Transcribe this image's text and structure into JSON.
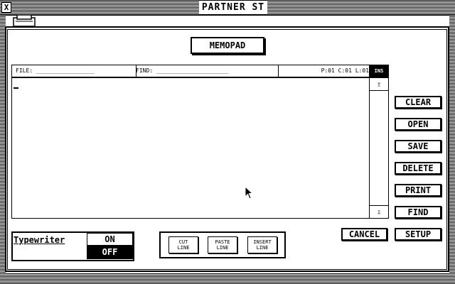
{
  "window": {
    "title": "PARTNER ST",
    "close_glyph": "X"
  },
  "dialog": {
    "heading": "MEMOPAD"
  },
  "infobar": {
    "file": "FILE: _________________",
    "find": "FIND: _____________________",
    "position": "P:01 C:01 L:01",
    "mode": "INS"
  },
  "editor": {
    "content": ""
  },
  "scrollbar": {
    "up_glyph": "⇧",
    "down_glyph": "⇩"
  },
  "side_buttons": {
    "clear": "CLEAR",
    "open": "OPEN",
    "save": "SAVE",
    "delete": "DELETE",
    "print": "PRINT",
    "find": "FIND",
    "setup": "SETUP",
    "cancel": "CANCEL"
  },
  "typewriter": {
    "label": "Typewriter",
    "on": "ON",
    "off": "OFF",
    "selected": "OFF"
  },
  "line_buttons": {
    "cut_1": "CUT",
    "cut_2": "LINE",
    "paste_1": "PASTE",
    "paste_2": "LINE",
    "insert_1": "INSERT",
    "insert_2": "LINE"
  },
  "icons": {
    "close": "close-icon",
    "disk": "disk-icon",
    "pointer": "mouse-pointer-icon",
    "scroll_up": "arrow-up-icon",
    "scroll_down": "arrow-down-icon"
  }
}
